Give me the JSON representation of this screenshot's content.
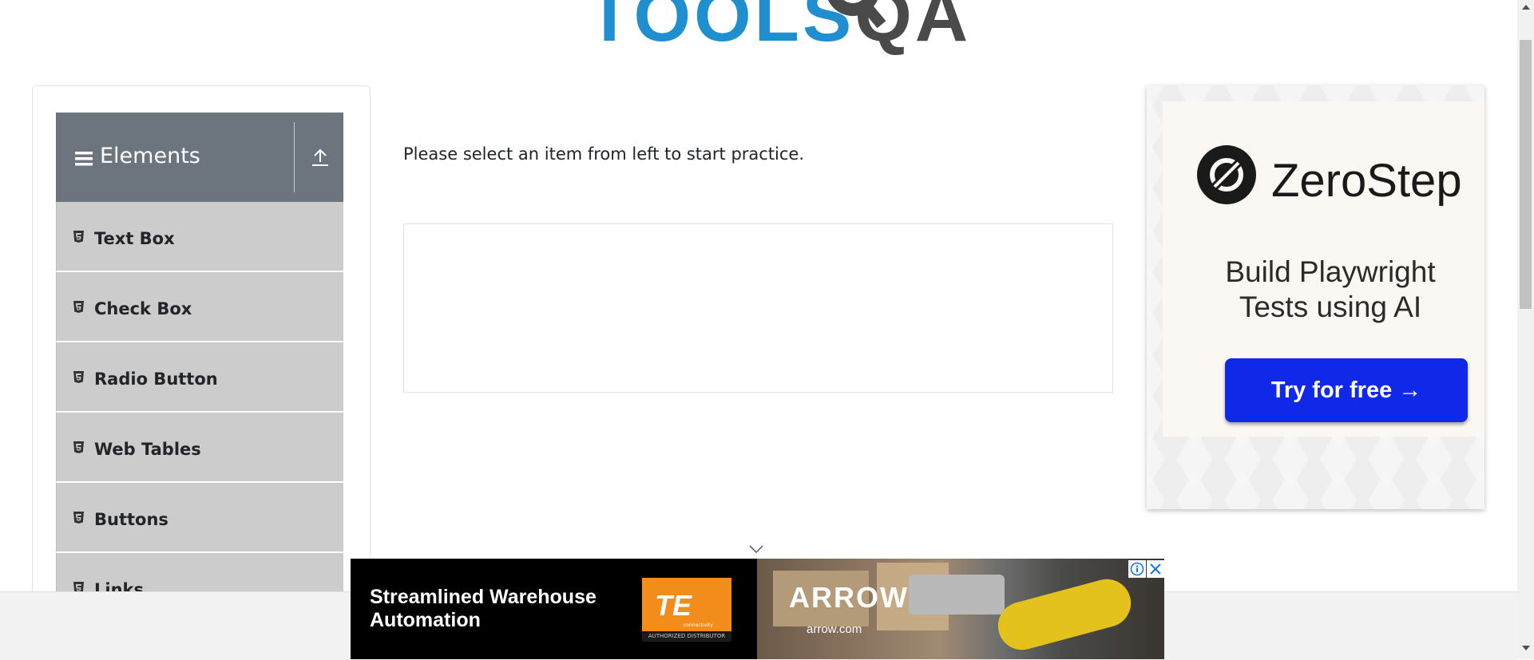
{
  "header": {
    "logo_text_left": "TOOLS",
    "logo_text_right": "QA"
  },
  "sidebar": {
    "group_title": "Elements",
    "items": [
      {
        "label": "Text Box"
      },
      {
        "label": "Check Box"
      },
      {
        "label": "Radio Button"
      },
      {
        "label": "Web Tables"
      },
      {
        "label": "Buttons"
      },
      {
        "label": "Links"
      }
    ]
  },
  "main": {
    "prompt": "Please select an item from left to start practice."
  },
  "side_ad": {
    "brand": "ZeroStep",
    "tagline_line1": "Build Playwright",
    "tagline_line2": "Tests using AI",
    "cta": "Try for free →"
  },
  "bottom_ad": {
    "headline": "Streamlined Warehouse Automation",
    "te_logo": "TE",
    "te_sub": "connectivity",
    "te_badge": "AUTHORIZED DISTRIBUTOR",
    "arrow_logo": "ARROW",
    "arrow_url": "arrow.com"
  },
  "colors": {
    "header_bg": "#6c757d",
    "menu_item_bg": "#cccccc",
    "logo_blue": "#1f8fcf",
    "cta_blue": "#1029e8",
    "te_orange": "#f28c1b"
  }
}
